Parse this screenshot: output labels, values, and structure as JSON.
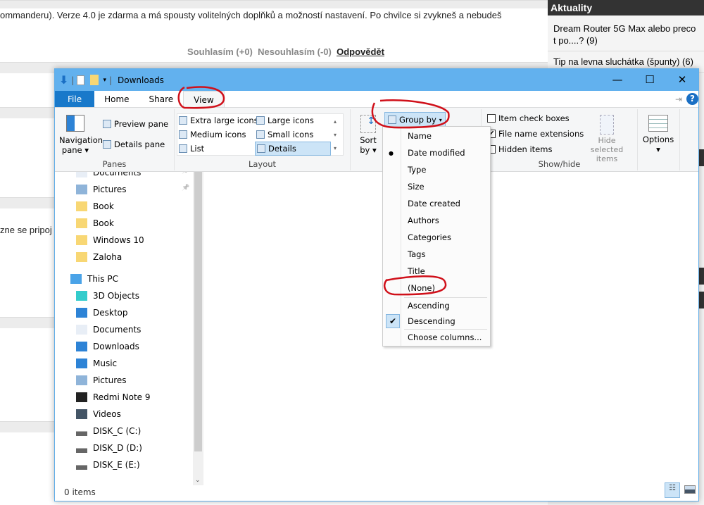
{
  "background": {
    "article_text": "ommanderu). Verze 4.0 je zdarma a má spousty volitelných doplňků a možností nastavení. Po chvilce si zvykneš a nebudeš",
    "agree": "Souhlasím (+0)",
    "disagree": "Nesouhlasím (-0)",
    "reply": "Odpovědět",
    "partial_text": "zne se pripoj",
    "sidebar": {
      "title": "Aktuality",
      "items": [
        "Dream Router 5G Max alebo preco t po....? (9)",
        "Tip na levna sluchátka (špunty) (6)"
      ]
    }
  },
  "window": {
    "title": "Downloads",
    "tabs": [
      "File",
      "Home",
      "Share",
      "View"
    ],
    "ribbon": {
      "panes": {
        "label": "Panes",
        "navigation_pane": "Navigation pane",
        "preview_pane": "Preview pane",
        "details_pane": "Details pane"
      },
      "layout": {
        "label": "Layout",
        "options": [
          "Extra large icons",
          "Large icons",
          "Medium icons",
          "Small icons",
          "List",
          "Details"
        ],
        "selected": "Details"
      },
      "current_view": {
        "sort_by": "Sort by",
        "group_by": "Group by"
      },
      "show_hide": {
        "label": "Show/hide",
        "item_check_boxes": "Item check boxes",
        "file_name_extensions": "File name extensions",
        "hidden_items": "Hidden items",
        "hide_selected": "Hide selected items",
        "checked": {
          "item_check_boxes": false,
          "file_name_extensions": true,
          "hidden_items": false
        }
      },
      "options": "Options"
    },
    "nav": {
      "quick_access": [
        "Documents",
        "Pictures",
        "Book",
        "Book",
        "Windows 10",
        "Zaloha"
      ],
      "this_pc": "This PC",
      "pc_items": [
        "3D Objects",
        "Desktop",
        "Documents",
        "Downloads",
        "Music",
        "Pictures",
        "Redmi Note 9",
        "Videos",
        "DISK_C (C:)",
        "DISK_D (D:)",
        "DISK_E (E:)"
      ]
    },
    "status": "0 items"
  },
  "group_menu": {
    "items": [
      "Name",
      "Date modified",
      "Type",
      "Size",
      "Date created",
      "Authors",
      "Categories",
      "Tags",
      "Title",
      "(None)"
    ],
    "selected": "Date modified",
    "order": [
      "Ascending",
      "Descending"
    ],
    "order_selected": "Descending",
    "choose": "Choose columns..."
  },
  "colors": {
    "titlebar": "#62b1ee",
    "file_tab": "#1979ca",
    "annotation": "#d0101a"
  }
}
